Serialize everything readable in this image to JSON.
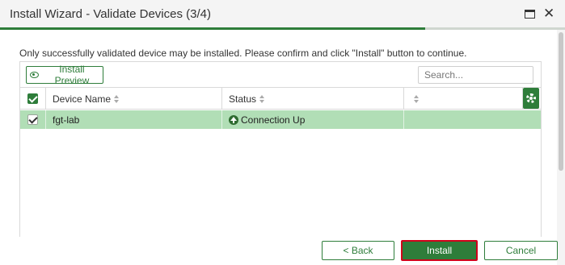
{
  "window": {
    "title": "Install Wizard - Validate Devices (3/4)",
    "progress_step": 3,
    "progress_total": 4
  },
  "instructions": "Only successfully validated device may be installed. Please confirm and click \"Install\" button to continue.",
  "toolbar": {
    "preview_label": "Install Preview",
    "search_placeholder": "Search..."
  },
  "table": {
    "columns": [
      "Device Name",
      "Status",
      ""
    ],
    "rows": [
      {
        "checked": true,
        "device_name": "fgt-lab",
        "status": "Connection Up",
        "status_icon": "arrow-up-circle-icon"
      }
    ]
  },
  "footer": {
    "back_label": "< Back",
    "install_label": "Install",
    "cancel_label": "Cancel"
  },
  "colors": {
    "accent": "#2e7d3a",
    "row_selected": "#b1deb6",
    "highlight_border": "#d0021b"
  }
}
